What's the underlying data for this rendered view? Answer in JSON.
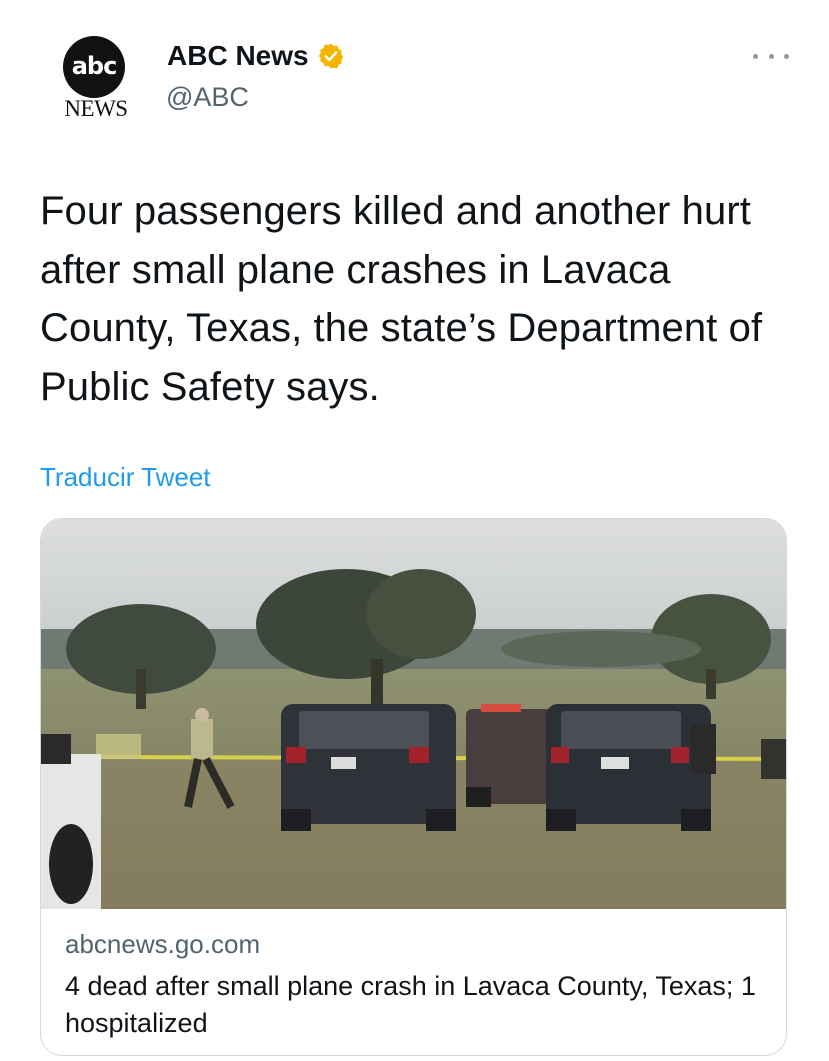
{
  "account": {
    "logo_text": "abc",
    "logo_subtext": "NEWS",
    "display_name": "ABC News",
    "handle": "@ABC",
    "verified_icon": "verified-badge-icon",
    "verified_color": "#f4b400"
  },
  "menu_icon": "more-options-icon",
  "tweet": {
    "text": "Four passengers killed and another hurt after small plane crashes in Lavaca County, Texas, the state’s Department of Public Safety says.",
    "translate_label": "Traducir Tweet"
  },
  "link_card": {
    "domain": "abcnews.go.com",
    "title": "4 dead after small plane crash in Lavaca County, Texas; 1 hospitalized"
  },
  "colors": {
    "link_blue": "#1d9bf0",
    "secondary_text": "#536471",
    "primary_text": "#0f1419"
  }
}
